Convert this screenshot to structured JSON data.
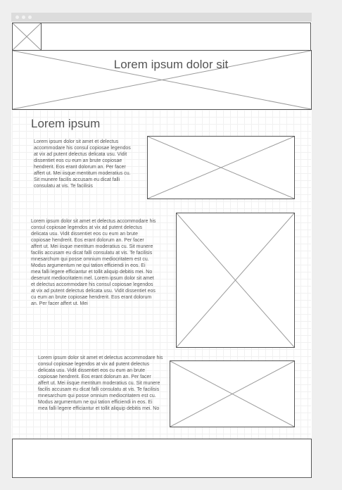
{
  "header": {
    "title": "Lorem ipsum dolor sit"
  },
  "section": {
    "heading": "Lorem ipsum",
    "paragraph_1": "Lorem ipsum dolor sit amet et delectus accommodare his consul copiosae legendos at vix ad putent delectus delicata usu. Vidit dissentiet eos cu eum an brute copiosae hendrerit. Eos erant dolorum an. Per facer affert ut. Mei iisque mentitum moderatius cu. Sit munere facilis accusam eu dicat falli consulatu at vis. Te facilisis",
    "paragraph_2": "Lorem ipsum dolor sit amet et delectus accommodare his consul copiosae legendos at vix ad putent delectus delicata usu. Vidit dissentiet eos cu eum an brute copiosae hendrerit. Eos erant dolorum an. Per facer affert ut. Mei iisque mentitum moderatius cu. Sit munere facilis accusam eu dicat falli consulatu at vis. Te facilisis mnesarchum qui posse omnium mediocritatem est cu. Modus argumentum ne qui tation efficiendi in eos. Ei mea falli legere efficiantur et tollit aliquip debitis mei. No deserunt mediocritatem mel. Lorem ipsum dolor sit amet et delectus accommodare his consul copiosae legendos at vix ad putent delectus delicata usu. Vidit dissentiet eos cu eum an brute copiosae hendrerit. Eos erant dolorum an. Per facer affert ut. Mei",
    "paragraph_3": "Lorem ipsum dolor sit amet et delectus accommodare his consul copiosae legendos at vix ad putent delectus delicata usu. Vidit dissentiet eos cu eum an brute copiosae hendrerit. Eos erant dolorum an. Per facer affert ut. Mei iisque mentitum moderatius cu. Sit munere facilis accusam eu dicat falli consulatu at vis. Te facilisis mnesarchum qui posse omnium mediocritatem est cu. Modus argumentum ne qui tation efficiendi in eos. Ei mea falli legere efficiantur et tollit aliquip debitis mei. No"
  }
}
